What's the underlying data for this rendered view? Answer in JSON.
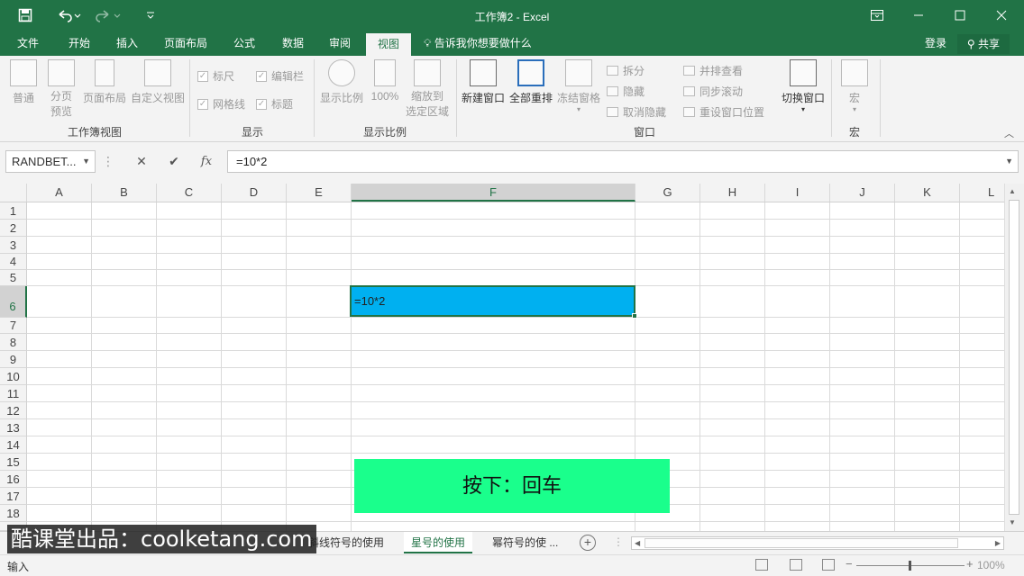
{
  "titlebar": {
    "title": "工作簿2 - Excel",
    "save_icon": "save-icon",
    "undo_icon": "undo-icon",
    "redo_icon": "redo-icon",
    "customize_icon": "customize-quick-access-icon"
  },
  "tabs": [
    "文件",
    "开始",
    "插入",
    "页面布局",
    "公式",
    "数据",
    "审阅",
    "视图"
  ],
  "active_tab": "视图",
  "tellme": "告诉我你想要做什么",
  "signin": "登录",
  "share": "共享",
  "ribbon": {
    "workbook_views": {
      "label": "工作簿视图",
      "normal": "普通",
      "page_break_1": "分页",
      "page_break_2": "预览",
      "page_layout": "页面布局",
      "custom_views": "自定义视图"
    },
    "show": {
      "label": "显示",
      "ruler": "标尺",
      "formula_bar": "编辑栏",
      "gridlines": "网格线",
      "headings": "标题"
    },
    "zoom": {
      "label": "显示比例",
      "zoom": "显示比例",
      "hundred": "100%",
      "zoom_sel_1": "缩放到",
      "zoom_sel_2": "选定区域"
    },
    "window": {
      "label": "窗口",
      "new_window": "新建窗口",
      "arrange_all": "全部重排",
      "freeze": "冻结窗格",
      "split": "拆分",
      "hide": "隐藏",
      "unhide": "取消隐藏",
      "side_by_side": "并排查看",
      "sync_scroll": "同步滚动",
      "reset_pos": "重设窗口位置",
      "switch": "切换窗口"
    },
    "macros": {
      "label": "宏",
      "macro": "宏"
    }
  },
  "formula_bar": {
    "name_box": "RANDBET...",
    "cancel": "✕",
    "enter": "✔",
    "fx": "fx",
    "formula": "=10*2"
  },
  "columns": [
    "A",
    "B",
    "C",
    "D",
    "E",
    "F",
    "G",
    "H",
    "I",
    "J",
    "K",
    "L"
  ],
  "rows": [
    "1",
    "2",
    "3",
    "4",
    "5",
    "6",
    "7",
    "8",
    "9",
    "10",
    "11",
    "12",
    "13",
    "14",
    "15",
    "16",
    "17",
    "18"
  ],
  "active_cell": {
    "text": "=10*2",
    "fill": "#00b0f0"
  },
  "key_hint": "按下：回车",
  "sheet_tabs": [
    "斜线符号的使用",
    "星号的使用",
    "幂符号的使 ..."
  ],
  "active_sheet": "星号的使用",
  "watermark": "酷课堂出品：coolketang.com",
  "status": "输入",
  "zoom_level": "100%",
  "colors": {
    "excel_green": "#217346",
    "key_hint_bg": "#1aff8c"
  }
}
